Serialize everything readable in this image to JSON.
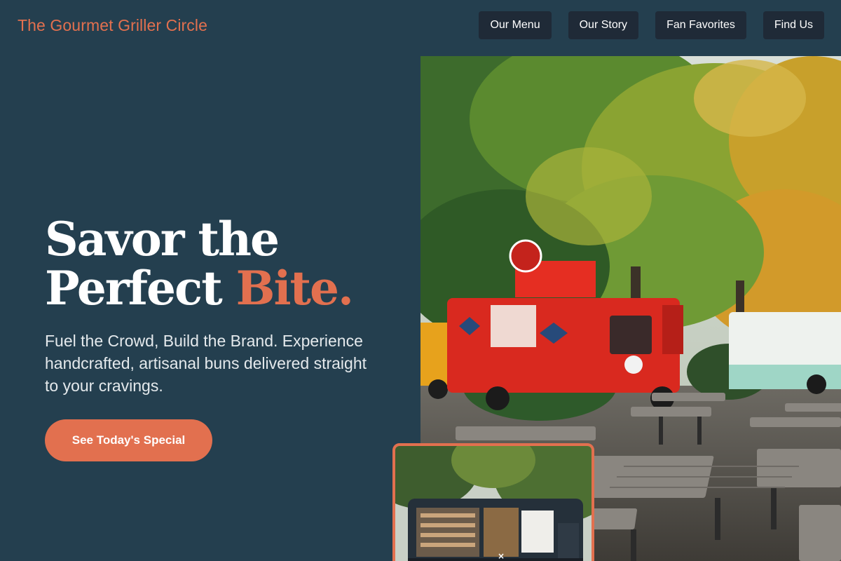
{
  "header": {
    "brand": "The Gourmet Griller Circle",
    "nav": [
      {
        "label": "Our Menu"
      },
      {
        "label": "Our Story"
      },
      {
        "label": "Fan Favorites"
      },
      {
        "label": "Find Us"
      }
    ]
  },
  "hero": {
    "title_line1": "Savor the",
    "title_line2": "Perfect",
    "title_accent": "Bite.",
    "subtitle": "Fuel the Crowd, Build the Brand. Experience handcrafted, artisanal buns delivered straight to your cravings.",
    "cta_label": "See Today's Special"
  },
  "images": {
    "main": {
      "alt": "Red food truck parked among autumn trees beside picnic tables",
      "icon": "food-truck-photo"
    },
    "inset": {
      "alt": "Dark food truck with open serving window",
      "icon": "food-truck-photo",
      "close_glyph": "×"
    }
  },
  "colors": {
    "background": "#243f4f",
    "accent": "#e2704f",
    "nav_button": "#1f2a37",
    "text": "#ffffff"
  }
}
